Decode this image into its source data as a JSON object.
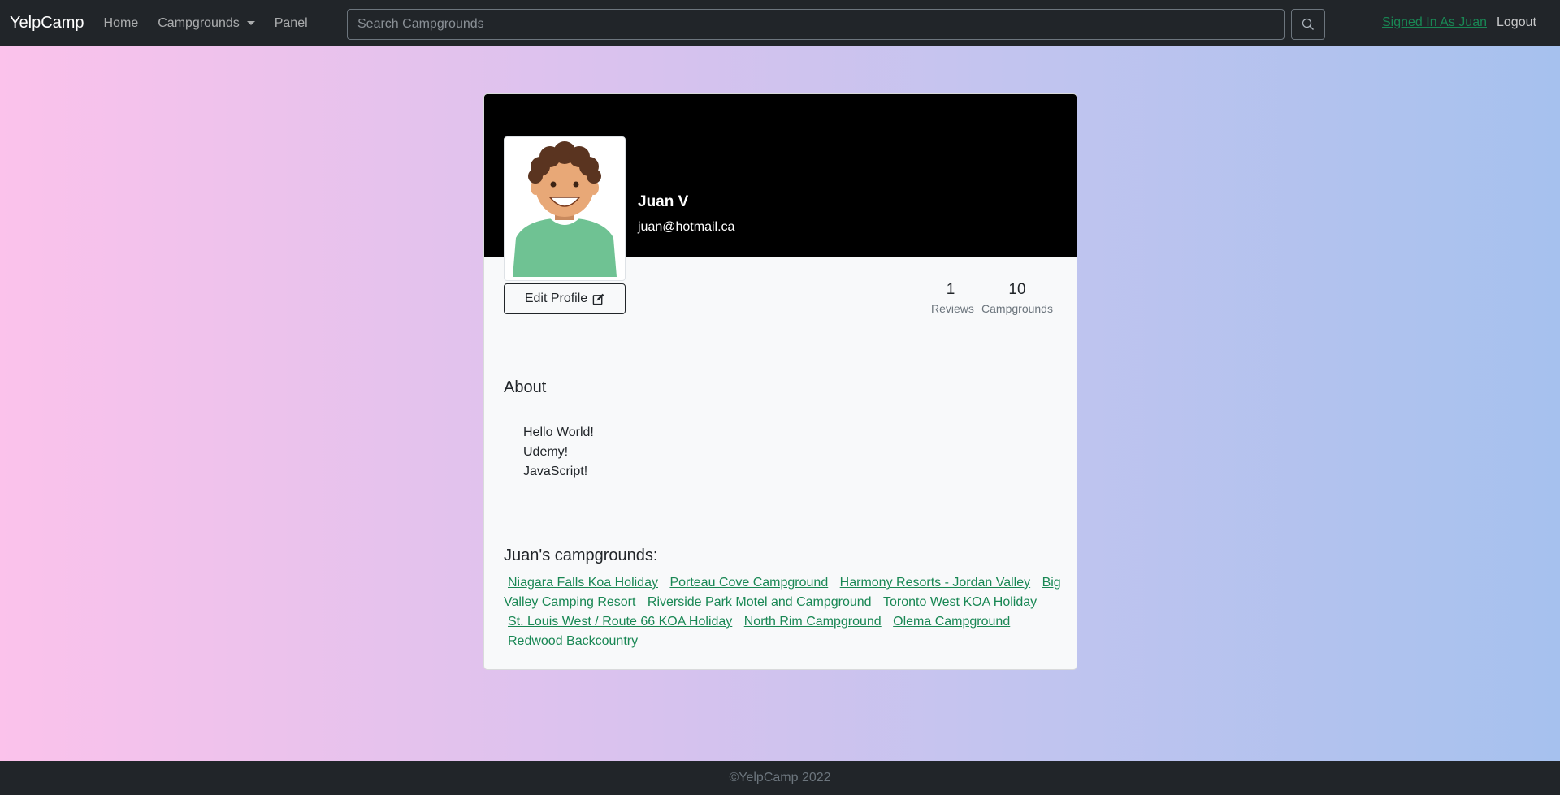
{
  "navbar": {
    "brand": "YelpCamp",
    "home": "Home",
    "campgrounds": "Campgrounds",
    "panel": "Panel",
    "search_placeholder": "Search Campgrounds",
    "signed_in": "Signed In As Juan",
    "logout": "Logout"
  },
  "profile": {
    "name": "Juan V",
    "email": "juan@hotmail.ca",
    "edit_label": "Edit Profile",
    "reviews_count": "1",
    "reviews_label": "Reviews",
    "campgrounds_count": "10",
    "campgrounds_label": "Campgrounds"
  },
  "about": {
    "title": "About",
    "lines": [
      "Hello World!",
      "Udemy!",
      "JavaScript!"
    ]
  },
  "campgrounds_section": {
    "title": "Juan's campgrounds:",
    "items": [
      "Niagara Falls Koa Holiday",
      "Porteau Cove Campground",
      "Harmony Resorts - Jordan Valley",
      "Big Valley Camping Resort",
      "Riverside Park Motel and Campground",
      "Toronto West KOA Holiday",
      "St. Louis West / Route 66 KOA Holiday",
      "North Rim Campground",
      "Olema Campground",
      "Redwood Backcountry"
    ]
  },
  "footer": {
    "copyright": "©YelpCamp 2022"
  },
  "colors": {
    "navbar_bg": "#212529",
    "link_green": "#198754",
    "card_bg": "#f8f9fa",
    "header_bg": "#000000",
    "shirt": "#6fc293",
    "skin": "#e8a877",
    "hair": "#5a3420"
  },
  "icons": {
    "search": "search-icon",
    "edit": "pencil-square-icon",
    "caret": "caret-down-icon"
  }
}
